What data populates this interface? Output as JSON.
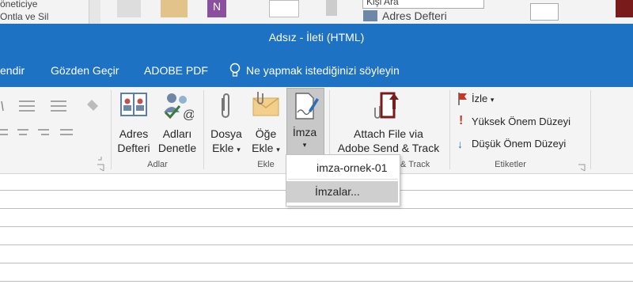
{
  "background_window": {
    "left_items": [
      "öneticiye",
      "Ontla ve Sil"
    ],
    "search_field_value": "Kişi Ara",
    "address_book_label": "Adres Defteri"
  },
  "window": {
    "title": "Adsız  -  İleti (HTML)"
  },
  "menu": {
    "items": [
      "endir",
      "Gözden Geçir",
      "ADOBE PDF"
    ],
    "tell_me": "Ne yapmak istediğinizi söyleyin"
  },
  "ribbon": {
    "adres_defteri": [
      "Adres",
      "Defteri"
    ],
    "adlari_denetle": [
      "Adları",
      "Denetle"
    ],
    "adlar_group": "Adlar",
    "dosya_ekle": [
      "Dosya",
      "Ekle"
    ],
    "oge_ekle": [
      "Öğe",
      "Ekle"
    ],
    "imza": "İmza",
    "ekle_group": "Ekle",
    "attach_file": [
      "Attach File via",
      "Adobe Send & Track"
    ],
    "attach_group_partial": "& Track",
    "izle": "İzle",
    "yuksek_onem": "Yüksek Önem Düzeyi",
    "dusuk_onem": "Düşük Önem Düzeyi",
    "etiketler_group": "Etiketler"
  },
  "dropdown": {
    "signature_item": "imza-ornek-01",
    "signatures_item": "İmzalar..."
  },
  "colors": {
    "accent": "#1e72c4",
    "ribbon_bg": "#f4f4f4",
    "highlight": "#cfcfcf"
  }
}
